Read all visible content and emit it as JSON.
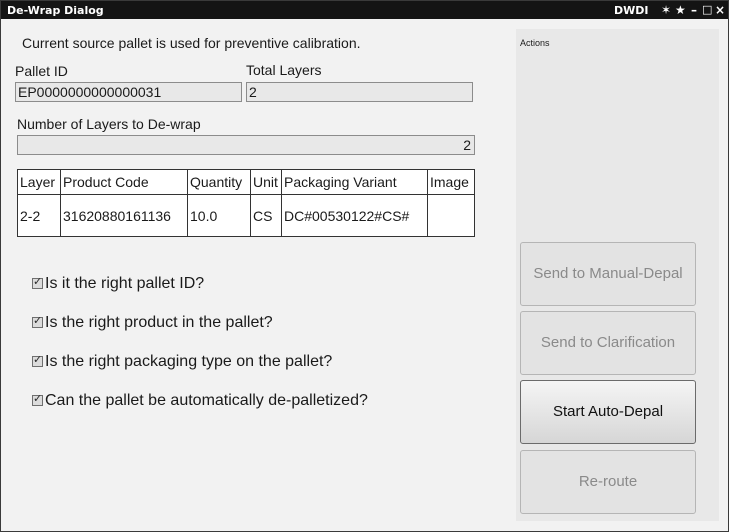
{
  "window": {
    "title": "De-Wrap Dialog",
    "app_name": "DWDI",
    "controls": {
      "pin": "✶",
      "star": "★",
      "minimize": "–",
      "maximize": "□",
      "close": "×"
    }
  },
  "info_message": "Current source pallet is used for preventive calibration.",
  "pallet_id": {
    "label": "Pallet ID",
    "value": "EP0000000000000031"
  },
  "total_layers": {
    "label": "Total Layers",
    "value": "2"
  },
  "layers_to_dewrap": {
    "label": "Number of Layers to De-wrap",
    "value": "2"
  },
  "table": {
    "headers": [
      "Layer",
      "Product Code",
      "Quantity",
      "Unit",
      "Packaging Variant",
      "Image"
    ],
    "rows": [
      [
        "2-2",
        "31620880161136",
        "10.0",
        "CS",
        "DC#00530122#CS#",
        ""
      ]
    ]
  },
  "checks": [
    {
      "label": "Is it the right pallet ID?",
      "checked": true,
      "mark": "✓"
    },
    {
      "label": "Is the right product in the pallet?",
      "checked": true,
      "mark": "✓"
    },
    {
      "label": "Is the right packaging type on the pallet?",
      "checked": true,
      "mark": "✓"
    },
    {
      "label": "Can the pallet be automatically de-palletized?",
      "checked": true,
      "mark": "✓"
    }
  ],
  "actions": {
    "title": "Actions",
    "buttons": [
      {
        "label": "Send to Manual-Depal",
        "enabled": false
      },
      {
        "label": "Send to Clarification",
        "enabled": false
      },
      {
        "label": "Start Auto-Depal",
        "enabled": true
      },
      {
        "label": "Re-route",
        "enabled": false
      }
    ]
  }
}
